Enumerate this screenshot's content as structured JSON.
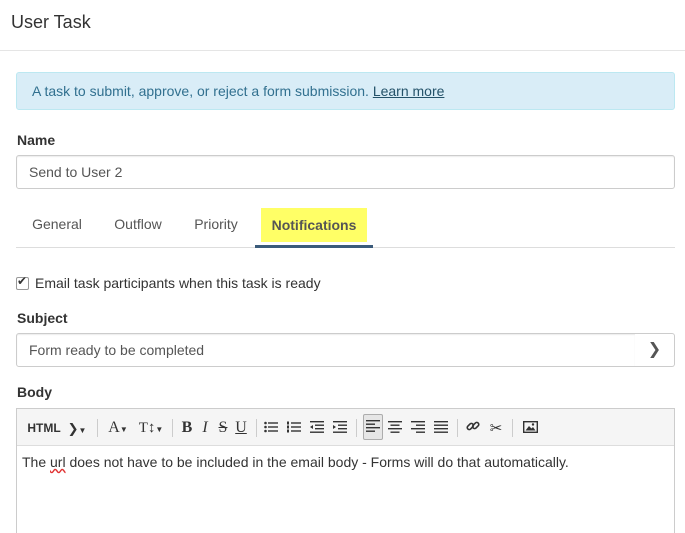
{
  "header": {
    "title": "User Task"
  },
  "info": {
    "text": "A task to submit, approve, or reject a form submission. ",
    "link": "Learn more"
  },
  "name": {
    "label": "Name",
    "value": "Send to User 2"
  },
  "tabs": [
    {
      "label": "General"
    },
    {
      "label": "Outflow"
    },
    {
      "label": "Priority"
    },
    {
      "label": "Notifications",
      "active": true
    }
  ],
  "email": {
    "label": "Email task participants when this task is ready",
    "checked": true
  },
  "subject": {
    "label": "Subject",
    "value": "Form ready to be completed",
    "button_icon": "chevron-right-icon"
  },
  "body": {
    "label": "Body",
    "toolbar": {
      "html_label": "HTML",
      "font_label": "A",
      "size_label": "T↕",
      "bold": "B",
      "italic": "I",
      "strike": "S",
      "underline": "U"
    },
    "text_pre": "The ",
    "text_misspelled": "url",
    "text_post": " does not have to be included in the email body - Forms will do that automatically."
  },
  "colors": {
    "info_bg": "#d9edf7",
    "info_text": "#31708f",
    "active_tab_underline": "#3b5b7a",
    "highlight": "#ffff66"
  }
}
